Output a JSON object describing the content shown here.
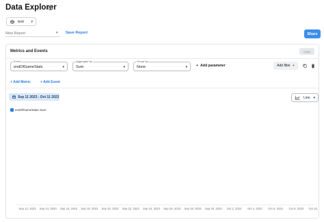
{
  "header": {
    "title": "Data Explorer",
    "info_icon": "info-icon"
  },
  "project": {
    "name": "test",
    "icon": "cube-icon"
  },
  "report": {
    "placeholder": "New Report",
    "save_label": "Save Report"
  },
  "share_label": "Share",
  "panel": {
    "title": "Metrics and Events",
    "apply_label": "Apply",
    "event": {
      "label": "Event",
      "value": "endOfGameStats"
    },
    "aggregate": {
      "label": "Aggregate by",
      "value": "Sum"
    },
    "group": {
      "label": "Group by",
      "value": "None"
    },
    "add_parameter_label": "Add parameter",
    "add_filter_label": "Add filter",
    "add_metric_label": "Add Metric",
    "add_event_label": "Add Event"
  },
  "toolbar": {
    "date_range": "Sep 11 2023 - Oct 11 2023",
    "chart_type": "Line"
  },
  "colors": {
    "accent": "#3d8fe8",
    "series": "#2a7de1"
  },
  "chart_data": {
    "type": "line",
    "series": [
      {
        "name": "endOfGameStats Sum",
        "values": []
      }
    ],
    "x_ticks": [
      "Sep 12, 2023",
      "Sep 14, 2023",
      "Sep 16, 2023",
      "Sep 18, 2023",
      "Sep 20, 2023",
      "Sep 22, 2023",
      "Sep 24, 2023",
      "Sep 26, 2023",
      "Sep 28, 2023",
      "Sep 30, 2023",
      "Oct 2, 2023",
      "Oct 4, 2023",
      "Oct 6, 2023",
      "Oct 8, 2023",
      "Oct 10, 2023"
    ],
    "grid": false,
    "legend": "top-left"
  }
}
